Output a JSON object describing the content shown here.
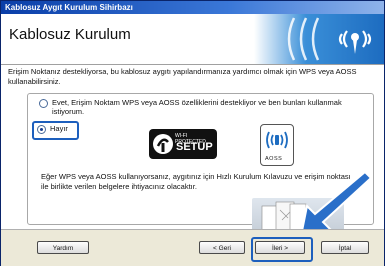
{
  "window": {
    "title": "Kablosuz Aygıt Kurulum Sihirbazı"
  },
  "header": {
    "title": "Kablosuz Kurulum"
  },
  "intro_text": "Erişim Noktanız destekliyorsa, bu kablosuz aygıtı yapılandırmanıza yardımcı olmak için WPS veya AOSS kullanabilirsiniz.",
  "options": [
    {
      "label": "Evet, Erişim Noktam WPS veya AOSS özelliklerini destekliyor ve ben bunları kullanmak istiyorum.",
      "selected": false
    },
    {
      "label": "Hayır",
      "selected": true
    }
  ],
  "logos": {
    "wps_small": "WI-FI PROTECTED",
    "wps_big": "SETUP",
    "aoss": "AOSS"
  },
  "note_text": "Eğer WPS veya AOSS kullanıyorsanız, aygıtınız için Hızlı Kurulum Kılavuzu ve erişim noktası ile birlikte verilen belgelere ihtiyacınız olacaktır.",
  "buttons": {
    "help": "Yardım",
    "back": "< Geri",
    "next": "İleri >",
    "cancel": "İptal"
  },
  "colors": {
    "accent": "#1d5fbd",
    "banner": "#1d6cc0",
    "arrow": "#2a6fc9"
  }
}
